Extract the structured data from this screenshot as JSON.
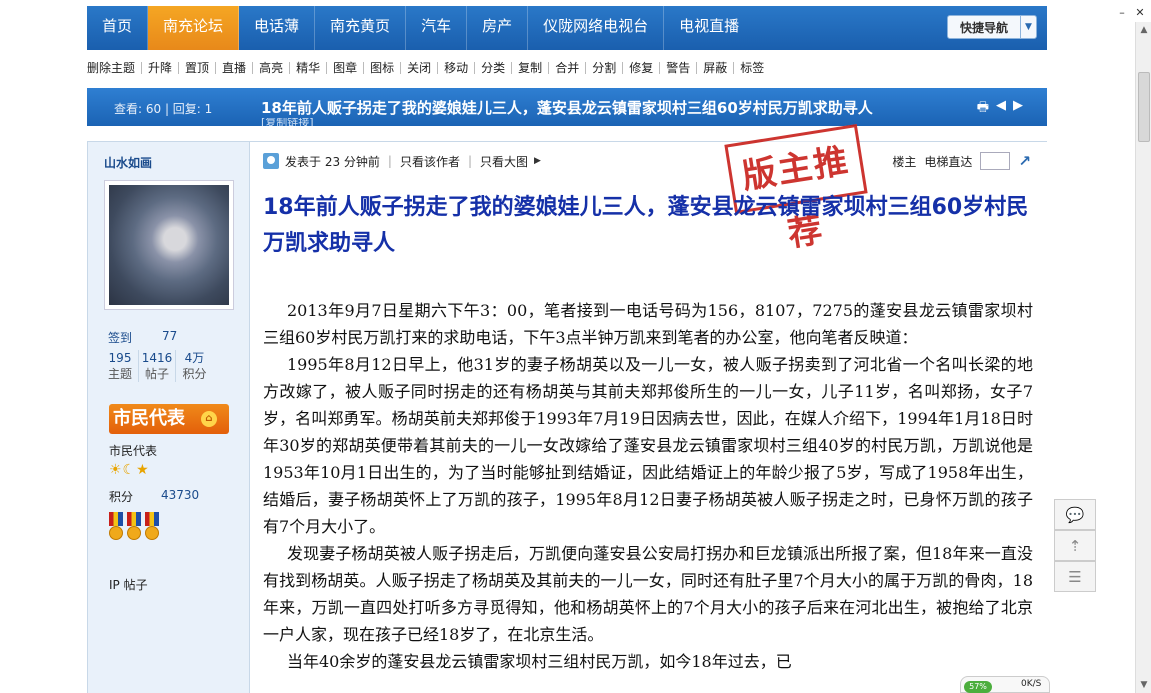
{
  "nav": {
    "items": [
      "首页",
      "南充论坛",
      "电话薄",
      "南充黄页",
      "汽车",
      "房产",
      "仪陇网络电视台",
      "电视直播"
    ],
    "active_index": 1,
    "quick_nav": "快捷导航"
  },
  "mod_actions": [
    "删除主题",
    "升降",
    "置顶",
    "直播",
    "高亮",
    "精华",
    "图章",
    "图标",
    "关闭",
    "移动",
    "分类",
    "复制",
    "合并",
    "分割",
    "修复",
    "警告",
    "屏蔽",
    "标签"
  ],
  "thread": {
    "stats": "查看: 60 | 回复: 1",
    "title": "18年前人贩子拐走了我的婆娘娃儿三人，蓬安县龙云镇雷家坝村三组60岁村民万凯求助寻人",
    "copy_link": "[复制链接]"
  },
  "author": {
    "name": "山水如画",
    "sign_label": "签到",
    "sign_value": "77",
    "stats": [
      {
        "value": "195",
        "label": "主题"
      },
      {
        "value": "1416",
        "label": "帖子"
      },
      {
        "value": "4万",
        "label": "积分"
      }
    ],
    "rank_badge": "市民代表",
    "rank_name": "市民代表",
    "points_label": "积分",
    "points_value": "43730",
    "ip_label": "IP 帖子"
  },
  "post": {
    "posted_at": "发表于 23 分钟前",
    "only_author": "只看该作者",
    "large_images": "只看大图",
    "floor_label": "楼主",
    "jump_label": "电梯直达",
    "stamp": "版主推荐",
    "title": "18年前人贩子拐走了我的婆娘娃儿三人，蓬安县龙云镇雷家坝村三组60岁村民万凯求助寻人",
    "paragraphs": [
      "2013年9月7日星期六下午3：00，笔者接到一电话号码为156，8107，7275的蓬安县龙云镇雷家坝村三组60岁村民万凯打来的求助电话，下午3点半钟万凯来到笔者的办公室，他向笔者反映道：",
      "1995年8月12日早上，他31岁的妻子杨胡英以及一儿一女，被人贩子拐卖到了河北省一个名叫长梁的地方改嫁了，被人贩子同时拐走的还有杨胡英与其前夫郑邦俊所生的一儿一女，儿子11岁，名叫郑扬，女子7岁，名叫郑勇军。杨胡英前夫郑邦俊于1993年7月19日因病去世，因此，在媒人介绍下，1994年1月18日时年30岁的郑胡英便带着其前夫的一儿一女改嫁给了蓬安县龙云镇雷家坝村三组40岁的村民万凯，万凯说他是1953年10月1日出生的，为了当时能够扯到结婚证，因此结婚证上的年龄少报了5岁，写成了1958年出生，结婚后，妻子杨胡英怀上了万凯的孩子，1995年8月12日妻子杨胡英被人贩子拐走之时，已身怀万凯的孩子有7个月大小了。",
      "发现妻子杨胡英被人贩子拐走后，万凯便向蓬安县公安局打拐办和巨龙镇派出所报了案，但18年来一直没有找到杨胡英。人贩子拐走了杨胡英及其前夫的一儿一女，同时还有肚子里7个月大小的属于万凯的骨肉，18年来，万凯一直四处打听多方寻觅得知，他和杨胡英怀上的7个月大小的孩子后来在河北出生，被抱给了北京一户人家，现在孩子已经18岁了，在北京生活。",
      "当年40余岁的蓬安县龙云镇雷家坝村三组村民万凯，如今18年过去，已"
    ]
  },
  "net_widget": {
    "percent": "57%",
    "speed": "0K/S"
  }
}
